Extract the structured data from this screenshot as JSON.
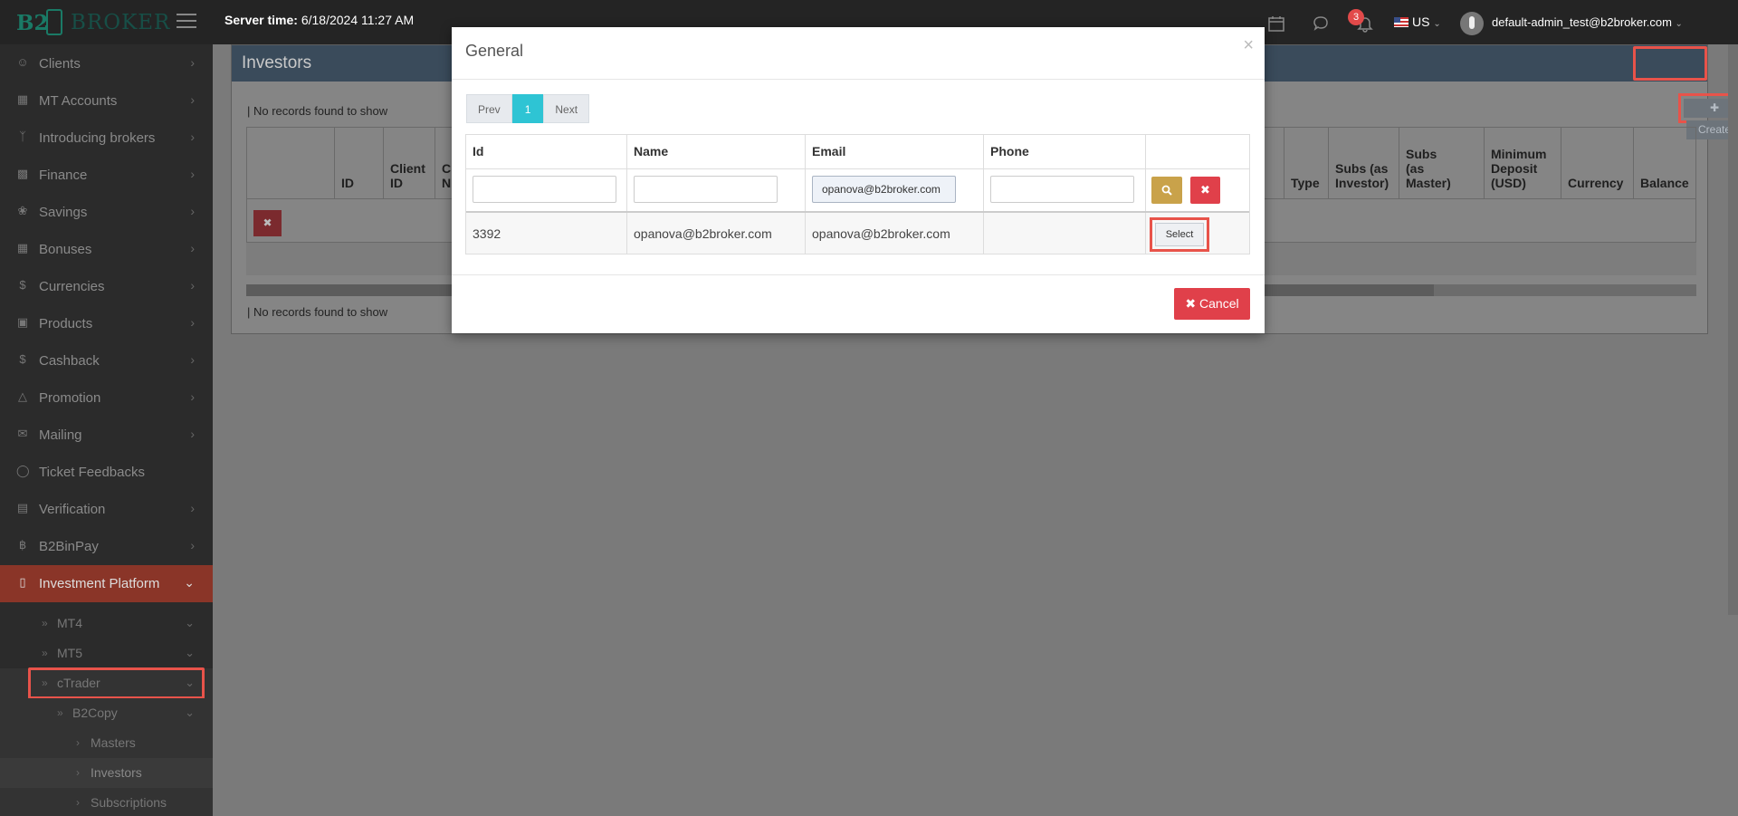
{
  "topbar": {
    "logo_b2": "B2",
    "logo_broker": "BROKER",
    "server_time_label": "Server time:",
    "server_time_value": "6/18/2024 11:27 AM",
    "notification_count": "3",
    "language": "US",
    "user_email": "default-admin_test@b2broker.com",
    "icons": [
      "calendar-icon",
      "chat-icon",
      "bell-icon",
      "flag-icon",
      "avatar-icon",
      "chevron-down-icon"
    ]
  },
  "sidebar": {
    "items": [
      {
        "label": "Clients",
        "icon": "user-icon"
      },
      {
        "label": "MT Accounts",
        "icon": "bar-chart-icon"
      },
      {
        "label": "Introducing brokers",
        "icon": "branch-icon"
      },
      {
        "label": "Finance",
        "icon": "money-icon"
      },
      {
        "label": "Savings",
        "icon": "leaf-icon"
      },
      {
        "label": "Bonuses",
        "icon": "gift-icon"
      },
      {
        "label": "Currencies",
        "icon": "dollar-icon"
      },
      {
        "label": "Products",
        "icon": "briefcase-icon"
      },
      {
        "label": "Cashback",
        "icon": "dollar-icon"
      },
      {
        "label": "Promotion",
        "icon": "bell-icon"
      },
      {
        "label": "Mailing",
        "icon": "envelope-icon"
      },
      {
        "label": "Ticket Feedbacks",
        "icon": "chat-icon"
      },
      {
        "label": "Verification",
        "icon": "document-icon"
      },
      {
        "label": "B2BinPay",
        "icon": "bitcoin-icon"
      },
      {
        "label": "Investment Platform",
        "icon": "folder-open-icon"
      }
    ],
    "sub_items": [
      {
        "label": "MT4"
      },
      {
        "label": "MT5"
      },
      {
        "label": "cTrader"
      },
      {
        "label": "B2Copy"
      },
      {
        "label": "Masters"
      },
      {
        "label": "Investors"
      },
      {
        "label": "Subscriptions"
      }
    ]
  },
  "main": {
    "panel_title": "Investors",
    "create_label": "Create",
    "no_records_top": "No records found to show",
    "no_records_bottom": "No records found to show",
    "columns": [
      "ID",
      "Client ID",
      "Cl N",
      "Type",
      "Subs (as Investor)",
      "Subs (as Master)",
      "Minimum Deposit (USD)",
      "Currency",
      "Balance"
    ]
  },
  "modal": {
    "title": "General",
    "close": "×",
    "pager": {
      "prev": "Prev",
      "current": "1",
      "next": "Next"
    },
    "columns": [
      "Id",
      "Name",
      "Email",
      "Phone"
    ],
    "filters": {
      "id": "",
      "name": "",
      "email": "opanova@b2broker.com",
      "phone": ""
    },
    "rows": [
      {
        "id": "3392",
        "name": "opanova@b2broker.com",
        "email": "opanova@b2broker.com",
        "phone": "",
        "action": "Select"
      }
    ],
    "cancel_label": "Cancel"
  },
  "colors": {
    "accent_teal": "#2ec4d4",
    "danger": "#e0404a",
    "search_gold": "#c9a24a",
    "highlight": "#e8534a",
    "sidebar_active": "#8a3528"
  }
}
